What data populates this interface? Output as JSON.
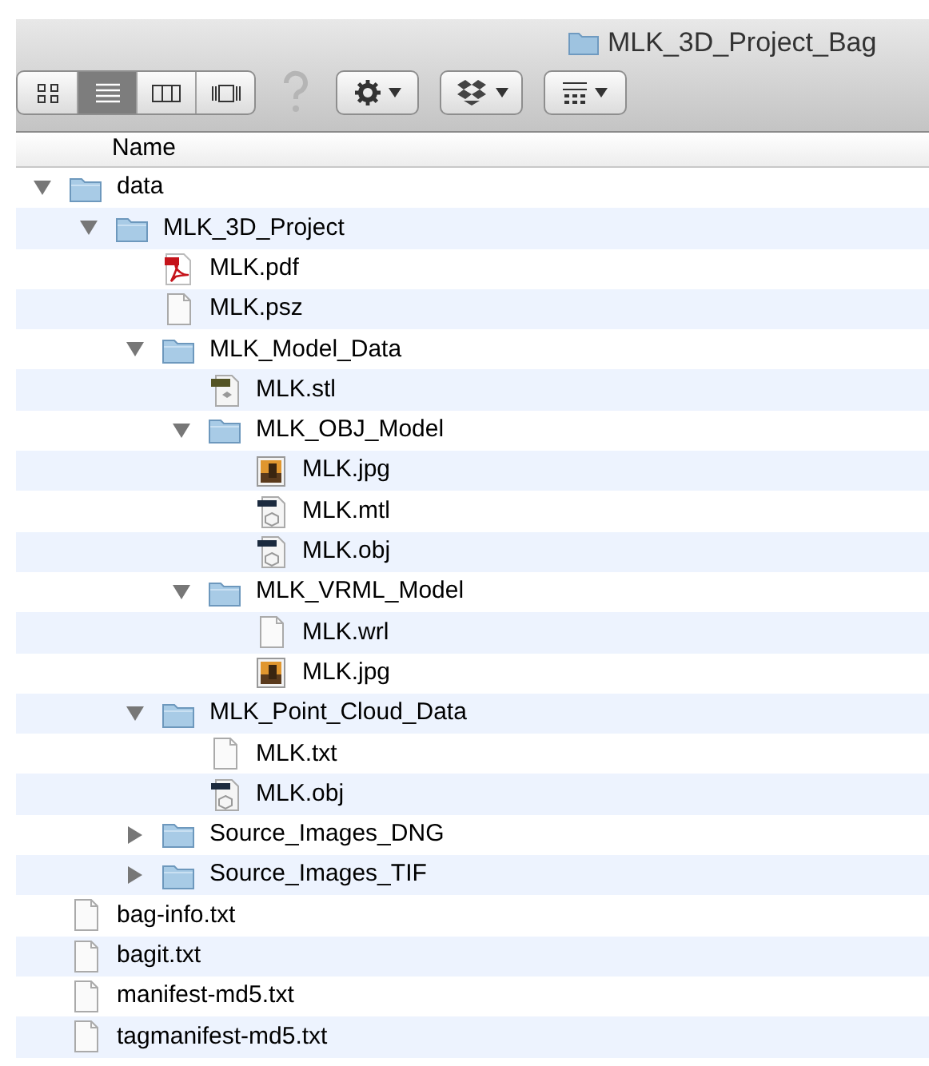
{
  "window": {
    "title": "MLK_3D_Project_Bag"
  },
  "toolbar": {
    "view_modes": [
      {
        "kind": "icons",
        "selected": false
      },
      {
        "kind": "list",
        "selected": true
      },
      {
        "kind": "columns",
        "selected": false
      },
      {
        "kind": "coverflow",
        "selected": false
      }
    ],
    "buttons": [
      {
        "kind": "action"
      },
      {
        "kind": "dropbox"
      },
      {
        "kind": "arrange"
      }
    ]
  },
  "columns": [
    "Name"
  ],
  "tree": [
    {
      "name": "data",
      "kind": "folder",
      "expanded": true,
      "children": [
        {
          "name": "MLK_3D_Project",
          "kind": "folder",
          "expanded": true,
          "children": [
            {
              "name": "MLK.pdf",
              "kind": "pdf"
            },
            {
              "name": "MLK.psz",
              "kind": "document"
            },
            {
              "name": "MLK_Model_Data",
              "kind": "folder",
              "expanded": true,
              "children": [
                {
                  "name": "MLK.stl",
                  "kind": "stl"
                },
                {
                  "name": "MLK_OBJ_Model",
                  "kind": "folder",
                  "expanded": true,
                  "children": [
                    {
                      "name": "MLK.jpg",
                      "kind": "image"
                    },
                    {
                      "name": "MLK.mtl",
                      "kind": "model"
                    },
                    {
                      "name": "MLK.obj",
                      "kind": "model"
                    }
                  ]
                },
                {
                  "name": "MLK_VRML_Model",
                  "kind": "folder",
                  "expanded": true,
                  "children": [
                    {
                      "name": "MLK.wrl",
                      "kind": "document"
                    },
                    {
                      "name": "MLK.jpg",
                      "kind": "image"
                    }
                  ]
                }
              ]
            },
            {
              "name": "MLK_Point_Cloud_Data",
              "kind": "folder",
              "expanded": true,
              "children": [
                {
                  "name": "MLK.txt",
                  "kind": "document"
                },
                {
                  "name": "MLK.obj",
                  "kind": "model"
                }
              ]
            },
            {
              "name": "Source_Images_DNG",
              "kind": "folder",
              "expanded": false
            },
            {
              "name": "Source_Images_TIF",
              "kind": "folder",
              "expanded": false
            }
          ]
        }
      ]
    },
    {
      "name": "bag-info.txt",
      "kind": "document"
    },
    {
      "name": "bagit.txt",
      "kind": "document"
    },
    {
      "name": "manifest-md5.txt",
      "kind": "document"
    },
    {
      "name": "tagmanifest-md5.txt",
      "kind": "document"
    }
  ]
}
